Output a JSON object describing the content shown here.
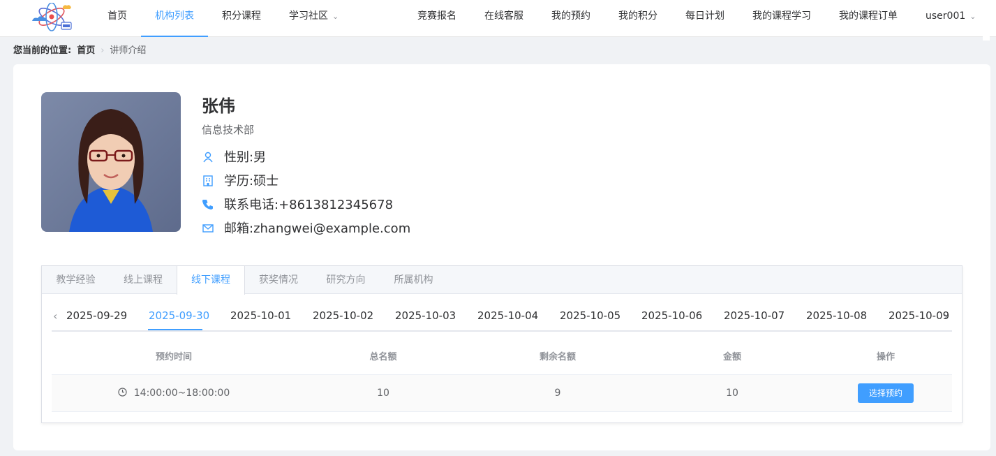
{
  "header": {
    "logo": "atom-cloud-logo",
    "nav_left": [
      {
        "label": "首页"
      },
      {
        "label": "机构列表",
        "active": true
      },
      {
        "label": "积分课程"
      },
      {
        "label": "学习社区",
        "dropdown": true
      }
    ],
    "nav_right": [
      {
        "label": "竞赛报名"
      },
      {
        "label": "在线客服"
      },
      {
        "label": "我的预约"
      },
      {
        "label": "我的积分"
      },
      {
        "label": "每日计划"
      },
      {
        "label": "我的课程学习"
      },
      {
        "label": "我的课程订单"
      },
      {
        "label": "user001",
        "dropdown": true
      }
    ]
  },
  "breadcrumb": {
    "label": "您当前的位置:",
    "home": "首页",
    "separator_icon": "chevron-right-icon",
    "current": "讲师介绍"
  },
  "teacher": {
    "name": "张伟",
    "department": "信息技术部",
    "gender": "性别:男",
    "education": "学历:硕士",
    "phone": "联系电话:+8613812345678",
    "email": "邮箱:zhangwei@example.com"
  },
  "tabs": [
    {
      "label": "教学经验"
    },
    {
      "label": "线上课程"
    },
    {
      "label": "线下课程",
      "active": true
    },
    {
      "label": "获奖情况"
    },
    {
      "label": "研究方向"
    },
    {
      "label": "所属机构"
    }
  ],
  "dates": {
    "items": [
      "2025-09-29",
      "2025-09-30",
      "2025-10-01",
      "2025-10-02",
      "2025-10-03",
      "2025-10-04",
      "2025-10-05",
      "2025-10-06",
      "2025-10-07",
      "2025-10-08",
      "2025-10-09"
    ],
    "selected": "2025-09-30"
  },
  "table": {
    "columns": [
      "预约时间",
      "总名额",
      "剩余名额",
      "金额",
      "操作"
    ],
    "rows": [
      {
        "time": "14:00:00~18:00:00",
        "total": "10",
        "remaining": "9",
        "price": "10",
        "action": "选择预约"
      }
    ]
  },
  "colors": {
    "accent": "#409eff",
    "background": "#f0f2f5"
  }
}
